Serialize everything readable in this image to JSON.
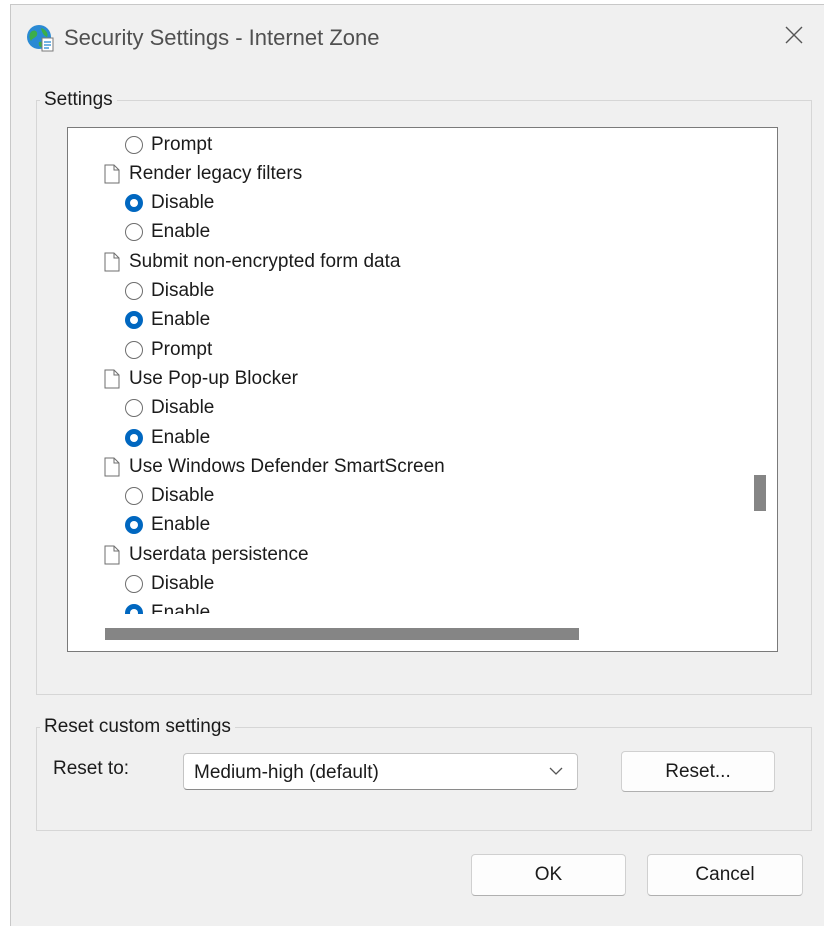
{
  "window": {
    "title": "Security Settings - Internet Zone"
  },
  "settings": {
    "legend": "Settings",
    "rows": [
      {
        "kind": "option",
        "label": "Prompt",
        "checked": false
      },
      {
        "kind": "heading",
        "label": "Render legacy filters"
      },
      {
        "kind": "option",
        "label": "Disable",
        "checked": true
      },
      {
        "kind": "option",
        "label": "Enable",
        "checked": false
      },
      {
        "kind": "heading",
        "label": "Submit non-encrypted form data"
      },
      {
        "kind": "option",
        "label": "Disable",
        "checked": false
      },
      {
        "kind": "option",
        "label": "Enable",
        "checked": true
      },
      {
        "kind": "option",
        "label": "Prompt",
        "checked": false
      },
      {
        "kind": "heading",
        "label": "Use Pop-up Blocker"
      },
      {
        "kind": "option",
        "label": "Disable",
        "checked": false
      },
      {
        "kind": "option",
        "label": "Enable",
        "checked": true
      },
      {
        "kind": "heading",
        "label": "Use Windows Defender SmartScreen"
      },
      {
        "kind": "option",
        "label": "Disable",
        "checked": false
      },
      {
        "kind": "option",
        "label": "Enable",
        "checked": true
      },
      {
        "kind": "heading",
        "label": "Userdata persistence"
      },
      {
        "kind": "option",
        "label": "Disable",
        "checked": false
      },
      {
        "kind": "option",
        "label": "Enable",
        "checked": true
      }
    ]
  },
  "reset": {
    "legend": "Reset custom settings",
    "reset_to_label": "Reset to:",
    "selected": "Medium-high (default)",
    "reset_button": "Reset..."
  },
  "footer": {
    "ok": "OK",
    "cancel": "Cancel"
  },
  "colors": {
    "accent": "#0067c0",
    "scrollbar": "#858585"
  }
}
